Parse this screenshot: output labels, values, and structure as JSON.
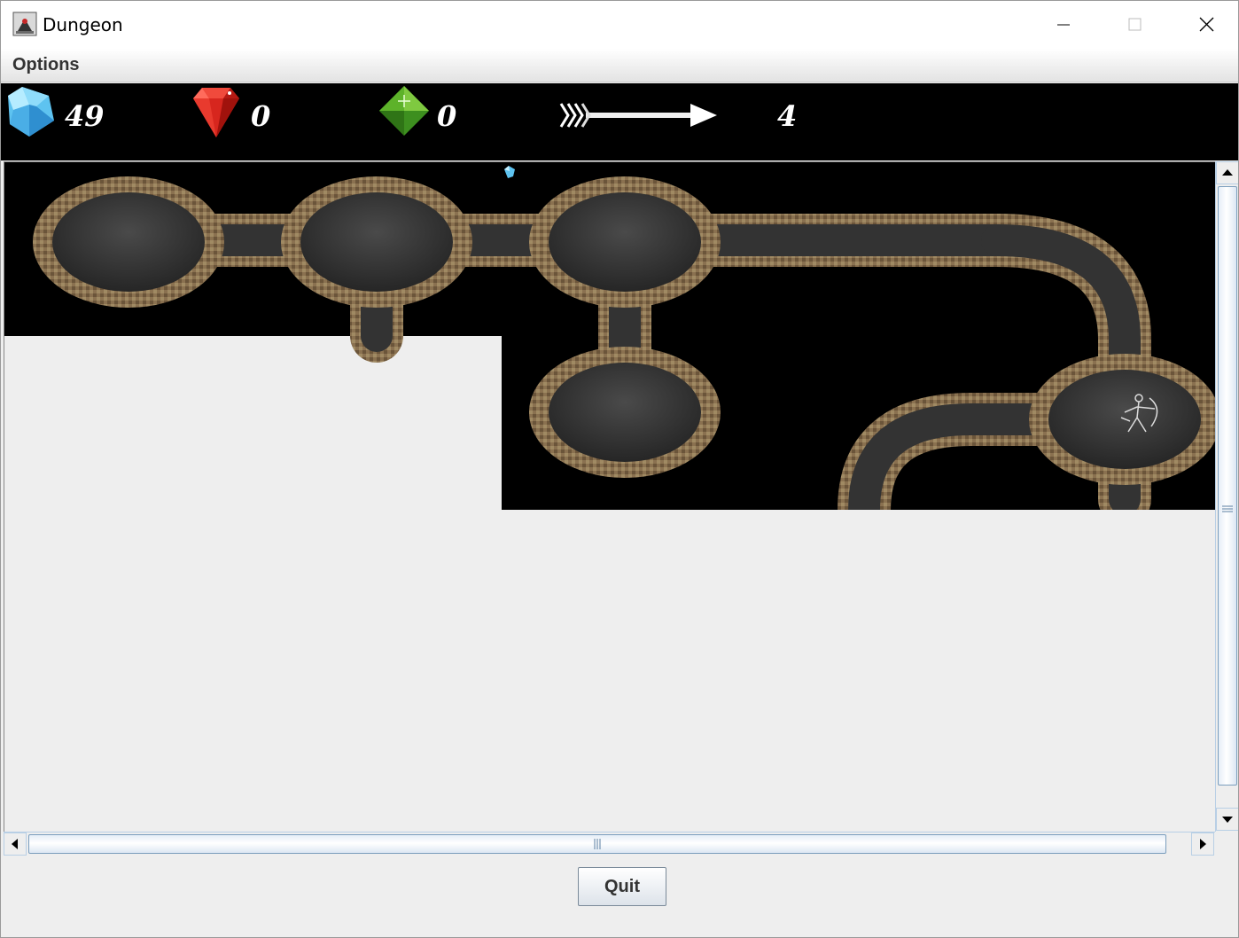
{
  "window": {
    "title": "Dungeon",
    "controls": [
      "minimize",
      "maximize",
      "close"
    ]
  },
  "menu": {
    "items": [
      {
        "label": "Options"
      }
    ]
  },
  "inventory": {
    "treasure": {
      "icon": "blue-diamond-icon",
      "count": "49"
    },
    "ruby": {
      "icon": "red-ruby-icon",
      "count": "0"
    },
    "emerald": {
      "icon": "green-emerald-icon",
      "count": "0"
    },
    "arrows": {
      "icon": "arrow-icon",
      "count": "4"
    }
  },
  "map": {
    "player_icon": "player-sprite-icon",
    "treasure_marker_icon": "blue-diamond-icon"
  },
  "buttons": {
    "quit": "Quit"
  },
  "colors": {
    "inventory_background": "#000000",
    "map_background": "#000000",
    "panel_background": "#eeeeee",
    "scrollbar_accent": "#7b9ebd",
    "title_accent": "#e8502a"
  }
}
